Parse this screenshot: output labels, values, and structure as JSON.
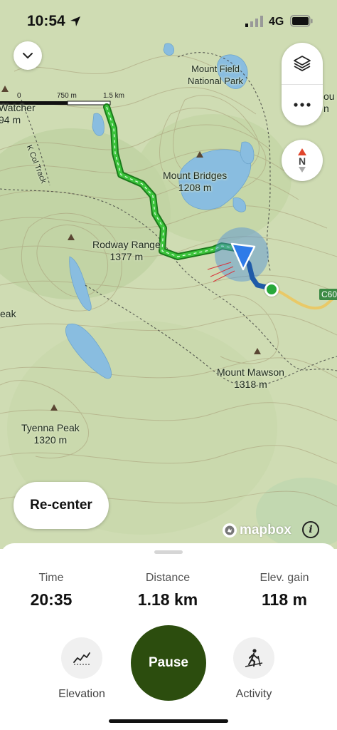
{
  "status": {
    "time": "10:54",
    "network": "4G"
  },
  "scale": {
    "start": "0",
    "mid": "750 m",
    "end": "1.5 km"
  },
  "map_labels": {
    "watcher": "Watcher",
    "watcher_elev": "94 m",
    "k_col_track": "K Col Track",
    "mount_field": "Mount Field",
    "national_park": "National Park",
    "mount_bridges": "Mount Bridges",
    "mount_bridges_elev": "1208 m",
    "rodway_range": "Rodway Range",
    "rodway_range_elev": "1377 m",
    "peak": "eak",
    "mount_mawson": "Mount Mawson",
    "mount_mawson_elev": "1318 m",
    "tyenna_peak": "Tyenna Peak",
    "tyenna_peak_elev": "1320 m",
    "road_badge": "C60",
    "edge_ou": "ou",
    "edge_n": "n"
  },
  "compass": {
    "label": "N"
  },
  "recenter_label": "Re-center",
  "attribution": "mapbox",
  "stats": [
    {
      "label": "Time",
      "value": "20:35"
    },
    {
      "label": "Distance",
      "value": "1.18 km"
    },
    {
      "label": "Elev. gain",
      "value": "118 m"
    }
  ],
  "actions": {
    "elevation_label": "Elevation",
    "pause_label": "Pause",
    "activity_label": "Activity"
  },
  "colors": {
    "track_green": "#3cc43c",
    "track_blue": "#1f5aa8",
    "pause_bg": "#2c4d0e",
    "lake": "#89bde0",
    "map_bg": "#cfdcb3"
  },
  "icons": {
    "status_location": "location-arrow-icon",
    "signal": "signal-bars-icon",
    "battery": "battery-icon",
    "collapse": "chevron-down-icon",
    "layers": "layers-icon",
    "more": "more-icon",
    "compass": "compass-icon",
    "user_position": "user-location-arrow-icon",
    "start": "start-point-icon",
    "mapbox_logo": "mapbox-logo-icon",
    "info": "info-icon",
    "elevation": "elevation-chart-icon",
    "activity": "hiking-icon"
  }
}
